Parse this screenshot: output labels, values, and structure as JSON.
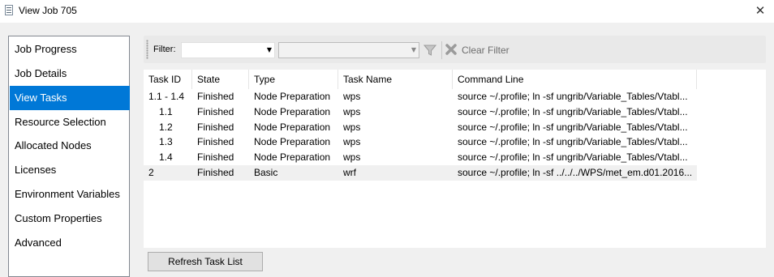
{
  "window": {
    "title": "View Job 705"
  },
  "sidebar": {
    "items": [
      {
        "label": "Job Progress",
        "selected": false
      },
      {
        "label": "Job Details",
        "selected": false
      },
      {
        "label": "View Tasks",
        "selected": true
      },
      {
        "label": "Resource Selection",
        "selected": false
      },
      {
        "label": "Allocated Nodes",
        "selected": false
      },
      {
        "label": "Licenses",
        "selected": false
      },
      {
        "label": "Environment Variables",
        "selected": false
      },
      {
        "label": "Custom Properties",
        "selected": false
      },
      {
        "label": "Advanced",
        "selected": false
      }
    ]
  },
  "toolbar": {
    "filter_label": "Filter:",
    "filter_field_value": "",
    "filter_value": "",
    "clear_filter_label": "Clear Filter"
  },
  "table": {
    "columns": [
      "Task ID",
      "State",
      "Type",
      "Task Name",
      "Command Line"
    ],
    "rows": [
      {
        "task_id": "1.1 - 1.4",
        "state": "Finished",
        "type": "Node Preparation",
        "task_name": "wps",
        "command": "source ~/.profile; ln -sf ungrib/Variable_Tables/Vtabl...",
        "selected": false
      },
      {
        "task_id": "1.1",
        "state": "Finished",
        "type": "Node Preparation",
        "task_name": "wps",
        "command": "source ~/.profile; ln -sf ungrib/Variable_Tables/Vtabl...",
        "selected": false
      },
      {
        "task_id": "1.2",
        "state": "Finished",
        "type": "Node Preparation",
        "task_name": "wps",
        "command": "source ~/.profile; ln -sf ungrib/Variable_Tables/Vtabl...",
        "selected": false
      },
      {
        "task_id": "1.3",
        "state": "Finished",
        "type": "Node Preparation",
        "task_name": "wps",
        "command": "source ~/.profile; ln -sf ungrib/Variable_Tables/Vtabl...",
        "selected": false
      },
      {
        "task_id": "1.4",
        "state": "Finished",
        "type": "Node Preparation",
        "task_name": "wps",
        "command": "source ~/.profile; ln -sf ungrib/Variable_Tables/Vtabl...",
        "selected": false
      },
      {
        "task_id": "2",
        "state": "Finished",
        "type": "Basic",
        "task_name": "wrf",
        "command": "source ~/.profile; ln -sf ../../../WPS/met_em.d01.2016...",
        "selected": true
      }
    ]
  },
  "footer": {
    "refresh_label": "Refresh Task List"
  },
  "colors": {
    "selection": "#0078d7",
    "selected_row": "#f0f0f0",
    "background": "#f0f0f0"
  }
}
